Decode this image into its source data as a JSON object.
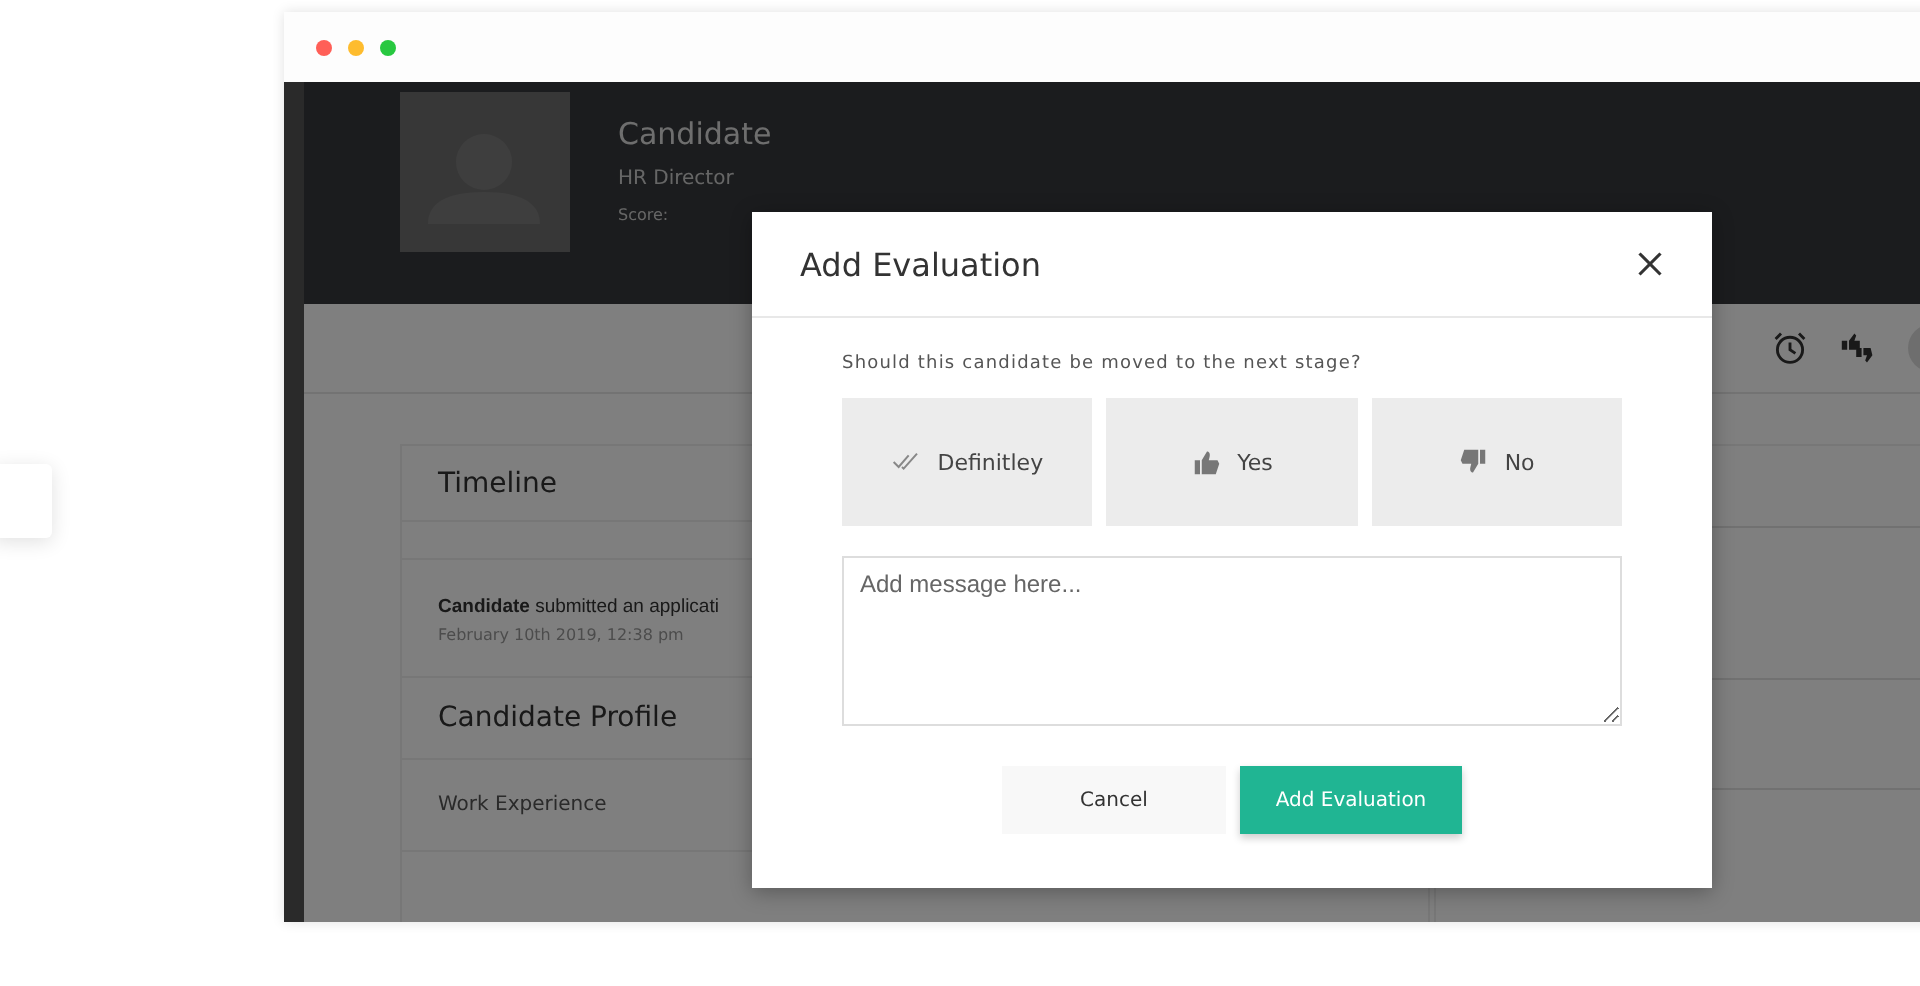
{
  "window": {
    "controls": [
      {
        "color": "#ff5f57"
      },
      {
        "color": "#febc2e"
      },
      {
        "color": "#28c840"
      }
    ]
  },
  "profile_header": {
    "name": "Candidate",
    "role": "HR Director",
    "score_label": "Score:"
  },
  "timeline": {
    "title": "Timeline",
    "entries": [
      {
        "text": "**Candidate** submitted an applicati",
        "date": "February 10th 2019, 12:38 pm"
      }
    ]
  },
  "candidate_profile": {
    "title": "Candidate Profile",
    "sections": [
      "Work Experience"
    ]
  },
  "modal": {
    "title": "Add Evaluation",
    "question": "Should this candidate be moved to the next stage?",
    "options": [
      {
        "kind": "definitely",
        "label": "Definitley",
        "selected": false
      },
      {
        "kind": "yes",
        "label": "Yes",
        "selected": false
      },
      {
        "kind": "no",
        "label": "No",
        "selected": false
      }
    ],
    "message": {
      "placeholder": "Add message here..."
    },
    "buttons": [
      {
        "kind": "secondary",
        "label": "Cancel"
      },
      {
        "kind": "primary",
        "label": "Add Evaluation"
      }
    ]
  }
}
